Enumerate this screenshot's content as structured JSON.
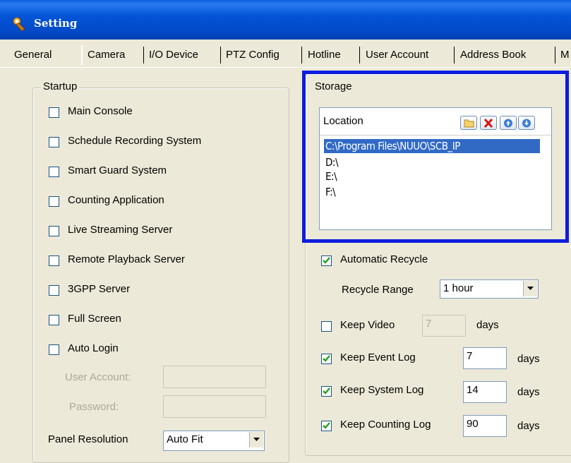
{
  "window": {
    "title": "Setting"
  },
  "tabs": [
    "General",
    "Camera",
    "I/O Device",
    "PTZ Config",
    "Hotline",
    "User Account",
    "Address Book",
    "M"
  ],
  "startup": {
    "legend": "Startup",
    "options": [
      {
        "label": "Main Console",
        "checked": false
      },
      {
        "label": "Schedule Recording System",
        "checked": false
      },
      {
        "label": "Smart Guard System",
        "checked": false
      },
      {
        "label": "Counting Application",
        "checked": false
      },
      {
        "label": "Live Streaming Server",
        "checked": false
      },
      {
        "label": "Remote Playback Server",
        "checked": false
      },
      {
        "label": "3GPP Server",
        "checked": false
      },
      {
        "label": "Full Screen",
        "checked": false
      },
      {
        "label": "Auto Login",
        "checked": false
      }
    ],
    "user_account_label": "User Account:",
    "password_label": "Password:",
    "panel_resolution_label": "Panel Resolution",
    "panel_resolution_value": "Auto Fit"
  },
  "storage": {
    "legend": "Storage",
    "list_header": "Location",
    "locations": [
      "C:\\Program Files\\NUUO\\SCB_IP",
      "D:\\",
      "E:\\",
      "F:\\"
    ],
    "selected_index": 0,
    "automatic_recycle_label": "Automatic Recycle",
    "recycle_range_label": "Recycle Range",
    "recycle_range_value": "1 hour",
    "keep_video_label": "Keep Video",
    "keep_video_value": "7",
    "keep_event_log_label": "Keep Event Log",
    "keep_event_log_value": "7",
    "keep_system_log_label": "Keep System Log",
    "keep_system_log_value": "14",
    "keep_counting_log_label": "Keep Counting Log",
    "keep_counting_log_value": "90",
    "days_label": "days"
  },
  "colors": {
    "title_bar": "#0454D8",
    "highlight_frame": "#0E1DDD",
    "selection": "#316AC5"
  }
}
